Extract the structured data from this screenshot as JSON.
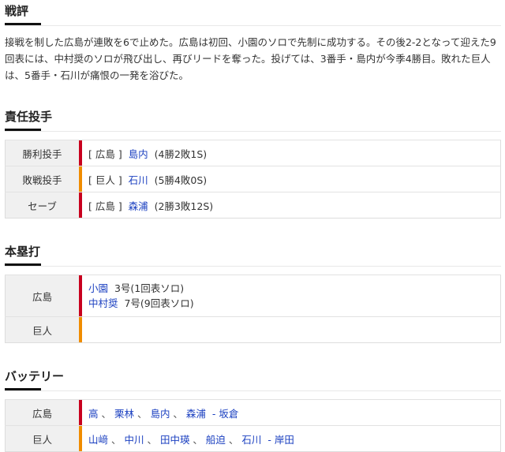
{
  "review": {
    "title": "戦評",
    "text": "接戦を制した広島が連敗を6で止めた。広島は初回、小園のソロで先制に成功する。その後2-2となって迎えた9回表には、中村奨のソロが飛び出し、再びリードを奪った。投げては、3番手・島内が今季4勝目。敗れた巨人は、5番手・石川が痛恨の一発を浴びた。"
  },
  "pitchers": {
    "title": "責任投手",
    "rows": [
      {
        "label": "勝利投手",
        "team": "[ 広島 ]",
        "name": "島内",
        "record": "(4勝2敗1S)",
        "color": "#c8001e"
      },
      {
        "label": "敗戦投手",
        "team": "[ 巨人 ]",
        "name": "石川",
        "record": "(5勝4敗0S)",
        "color": "#f08c00"
      },
      {
        "label": "セーブ",
        "team": "[ 広島 ]",
        "name": "森浦",
        "record": "(2勝3敗12S)",
        "color": "#c8001e"
      }
    ]
  },
  "homeruns": {
    "title": "本塁打",
    "rows": [
      {
        "label": "広島",
        "items": [
          {
            "name": "小園",
            "detail": "3号(1回表ソロ)"
          },
          {
            "name": "中村奨",
            "detail": "7号(9回表ソロ)"
          }
        ]
      },
      {
        "label": "巨人",
        "items": []
      }
    ]
  },
  "battery": {
    "title": "バッテリー",
    "rows": [
      {
        "label": "広島",
        "pitchers": [
          "高",
          "栗林",
          "島内",
          "森浦"
        ],
        "catcher": "坂倉"
      },
      {
        "label": "巨人",
        "pitchers": [
          "山﨑",
          "中川",
          "田中瑛",
          "船迫",
          "石川"
        ],
        "catcher": "岸田"
      }
    ]
  }
}
